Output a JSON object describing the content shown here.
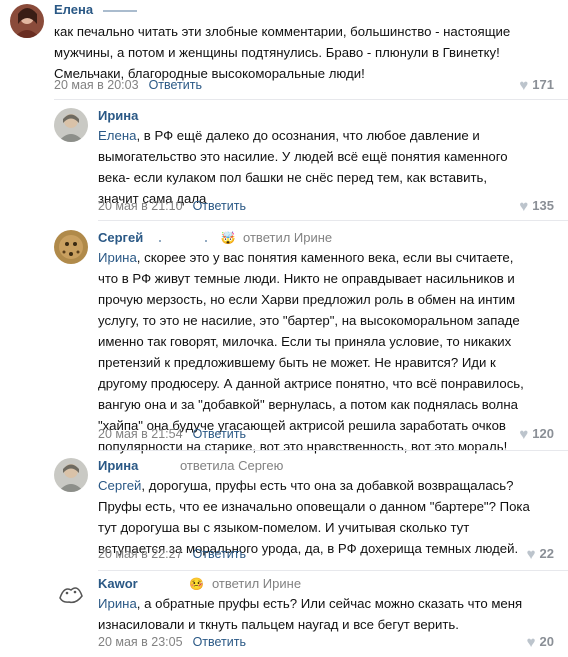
{
  "comments": [
    {
      "author": "Елена",
      "mention": "",
      "text": "как печально читать эти злобные комментарии, большинство - настоящие\nмужчины, а потом и женщины подтянулись. Браво - плюнули в Гвинетку!\nСмельчаки, благородные высокоморальные люди!",
      "date": "20 мая в 20:03",
      "reply_label": "Ответить",
      "likes": "171",
      "replied_to": ""
    },
    {
      "author": "Ирина",
      "mention": "Елена",
      "text": ", в РФ ещё далеко до осознания, что любое давление и\nвымогательство это насилие. У людей всё ещё понятия каменного\nвека- если кулаком пол башки не снёс перед тем, как вставить,\nзначит сама дала",
      "date": "20 мая в 21:10",
      "reply_label": "Ответить",
      "likes": "135",
      "replied_to": ""
    },
    {
      "author": "Сергей",
      "mention": "Ирина",
      "text": ", скорее это у вас понятия каменного века, если вы считаете,\nчто в РФ живут темные люди. Никто не оправдывает насильников и\nпрочую мерзость, но если Харви предложил роль в обмен на интим\nуслугу, то это не насилие, это \"бартер\", на высокоморальном западе\nименно так говорят, милочка. Если ты приняла условие, то никаких\nпретензий к предложившему быть не может. Не нравится? Иди к\nдругому продюсеру. А данной актрисе понятно, что всё понравилось,\nвангую она и за \"добавкой\" вернулась, а потом как поднялась волна\n\"хайпа\" она будуче угасающей актрисой решила заработать очков\nпопулярности на старике, вот это нравственность, вот это мораль!",
      "date": "20 мая в 21:54",
      "reply_label": "Ответить",
      "likes": "120",
      "replied_to": "ответил Ирине"
    },
    {
      "author": "Ирина",
      "mention": "Сергей",
      "text": ", дорогуша, пруфы есть что она за добавкой возвращалась?\nПруфы есть, что ее изначально оповещали о данном \"бартере\"? Пока\nтут дорогуша вы с языком-помелом. И учитывая сколько тут\nвступается за морального урода, да, в РФ дохерища темных людей.",
      "date": "20 мая в 22:27",
      "reply_label": "Ответить",
      "likes": "22",
      "replied_to": "ответила Сергею"
    },
    {
      "author": "Kawor",
      "mention": "Ирина",
      "text": ", а обратные пруфы есть? Или сейчас можно сказать что меня\nизнасиловали и ткнуть пальцем наугад и все бегут верить.",
      "date": "20 мая в 23:05",
      "reply_label": "Ответить",
      "likes": "20",
      "replied_to": "ответил Ирине"
    }
  ],
  "icons": {
    "like": "heart-icon",
    "reply_emoji": "face-emoji-icon"
  },
  "colors": {
    "link": "#2a5885",
    "muted": "#828282",
    "heart": "#bcc4cc"
  }
}
